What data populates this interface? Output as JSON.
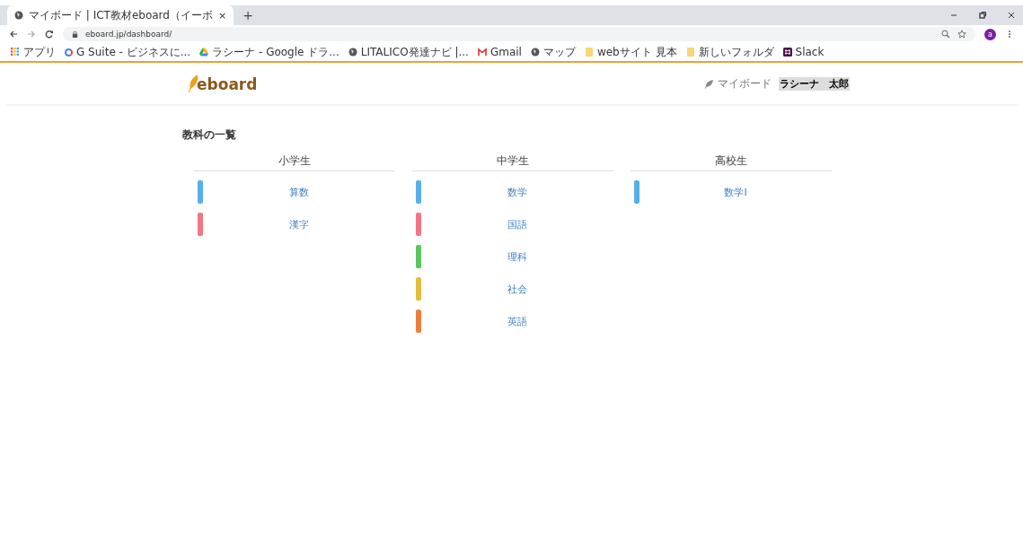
{
  "browser": {
    "tab_title": "マイボード | ICT教材eboard（イーボ",
    "tab_close": "×",
    "new_tab": "+",
    "url": "eboard.jp/dashboard/",
    "avatar": "a",
    "bookmarks": [
      {
        "label": "アプリ",
        "kind": "apps"
      },
      {
        "label": "G Suite - ビジネスに...",
        "kind": "google"
      },
      {
        "label": "ラシーナ - Google ドラ...",
        "kind": "drive"
      },
      {
        "label": "LITALICO発達ナビ |...",
        "kind": "globe"
      },
      {
        "label": "Gmail",
        "kind": "gmail"
      },
      {
        "label": "マップ",
        "kind": "globe"
      },
      {
        "label": "webサイト 見本",
        "kind": "folder"
      },
      {
        "label": "新しいフォルダ",
        "kind": "folder"
      },
      {
        "label": "Slack",
        "kind": "slack"
      }
    ]
  },
  "header": {
    "logo": "eboard",
    "mypage": "マイボード",
    "user": "ラシーナ　太郎"
  },
  "page_title": "教科の一覧",
  "groups": [
    {
      "title": "小学生",
      "subjects": [
        {
          "name": "算数",
          "color": "#55b0ea"
        },
        {
          "name": "漢字",
          "color": "#f37585"
        }
      ]
    },
    {
      "title": "中学生",
      "subjects": [
        {
          "name": "数学",
          "color": "#55b0ea"
        },
        {
          "name": "国語",
          "color": "#f37585"
        },
        {
          "name": "理科",
          "color": "#5cc55c"
        },
        {
          "name": "社会",
          "color": "#e1bf3a"
        },
        {
          "name": "英語",
          "color": "#ea7f3c"
        }
      ]
    },
    {
      "title": "高校生",
      "subjects": [
        {
          "name": "数学Ⅰ",
          "color": "#55b0ea"
        }
      ]
    }
  ]
}
